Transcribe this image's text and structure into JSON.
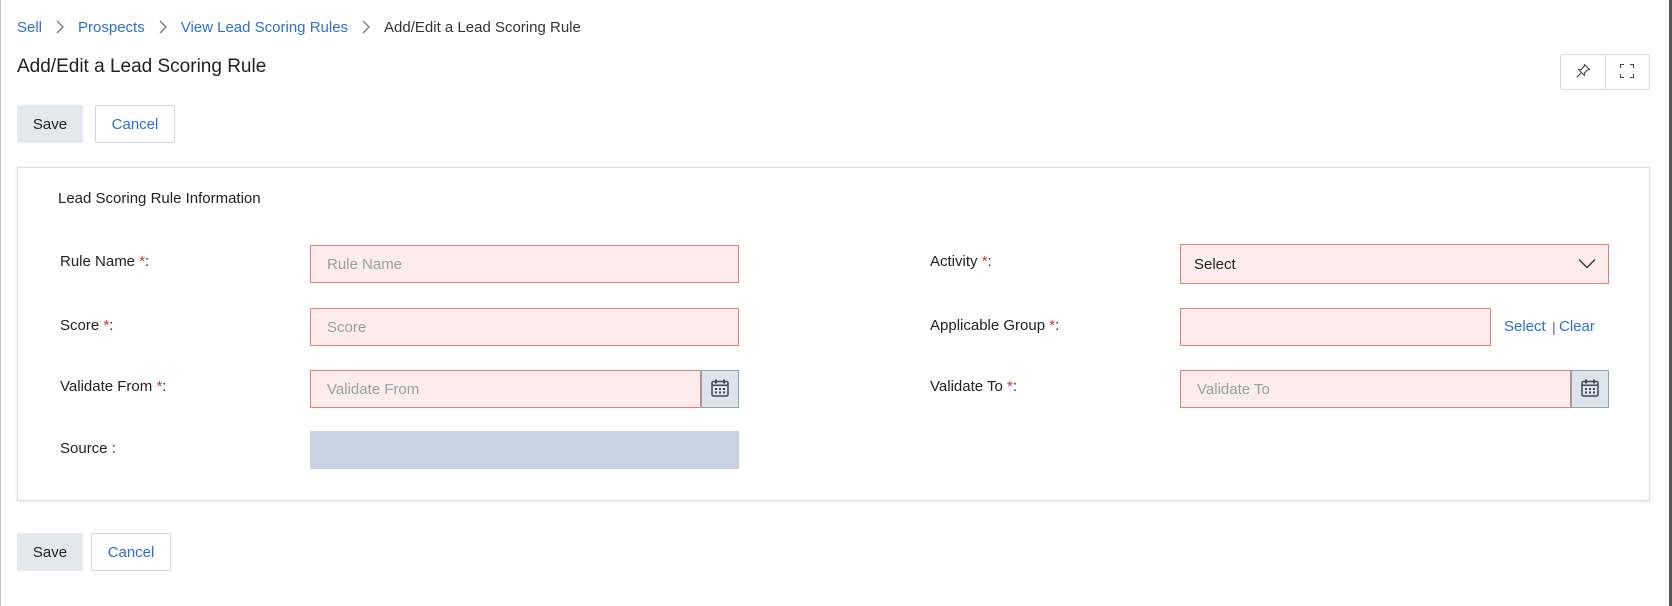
{
  "breadcrumb": {
    "items": [
      "Sell",
      "Prospects",
      "View Lead Scoring Rules"
    ],
    "current": "Add/Edit a Lead Scoring Rule"
  },
  "page": {
    "title": "Add/Edit a Lead Scoring Rule"
  },
  "actions": {
    "save_label": "Save",
    "cancel_label": "Cancel"
  },
  "form": {
    "section_title": "Lead Scoring Rule Information",
    "required_mark": "*",
    "rule_name": {
      "label": "Rule Name ",
      "suffix": ":",
      "placeholder": "Rule Name",
      "value": ""
    },
    "score": {
      "label": "Score  ",
      "suffix": ":",
      "placeholder": "Score",
      "value": ""
    },
    "validate_from": {
      "label": "Validate From  ",
      "suffix": ":",
      "placeholder": "Validate From",
      "value": ""
    },
    "source": {
      "label": "Source :"
    },
    "activity": {
      "label": "Activity ",
      "suffix": ":",
      "selected": "Select"
    },
    "applicable_group": {
      "label": "Applicable Group ",
      "suffix": ":",
      "select_link": "Select",
      "divider": "|",
      "clear_link": "Clear",
      "value": ""
    },
    "validate_to": {
      "label": "Validate To  ",
      "suffix": ":",
      "placeholder": "Validate To",
      "value": ""
    }
  },
  "icons": {
    "breadcrumb_separator": "chevron-right-icon",
    "pin": "pin-icon",
    "fullscreen": "fullscreen-icon",
    "calendar": "calendar-icon",
    "dropdown": "chevron-down-icon"
  },
  "colors": {
    "link": "#2f6fd1",
    "required": "#d0342c",
    "invalid_field_bg": "#fdecec",
    "invalid_field_border": "#e07b7b",
    "disabled_field_bg": "#c9d3df",
    "save_button_bg": "#e3e8ef"
  }
}
